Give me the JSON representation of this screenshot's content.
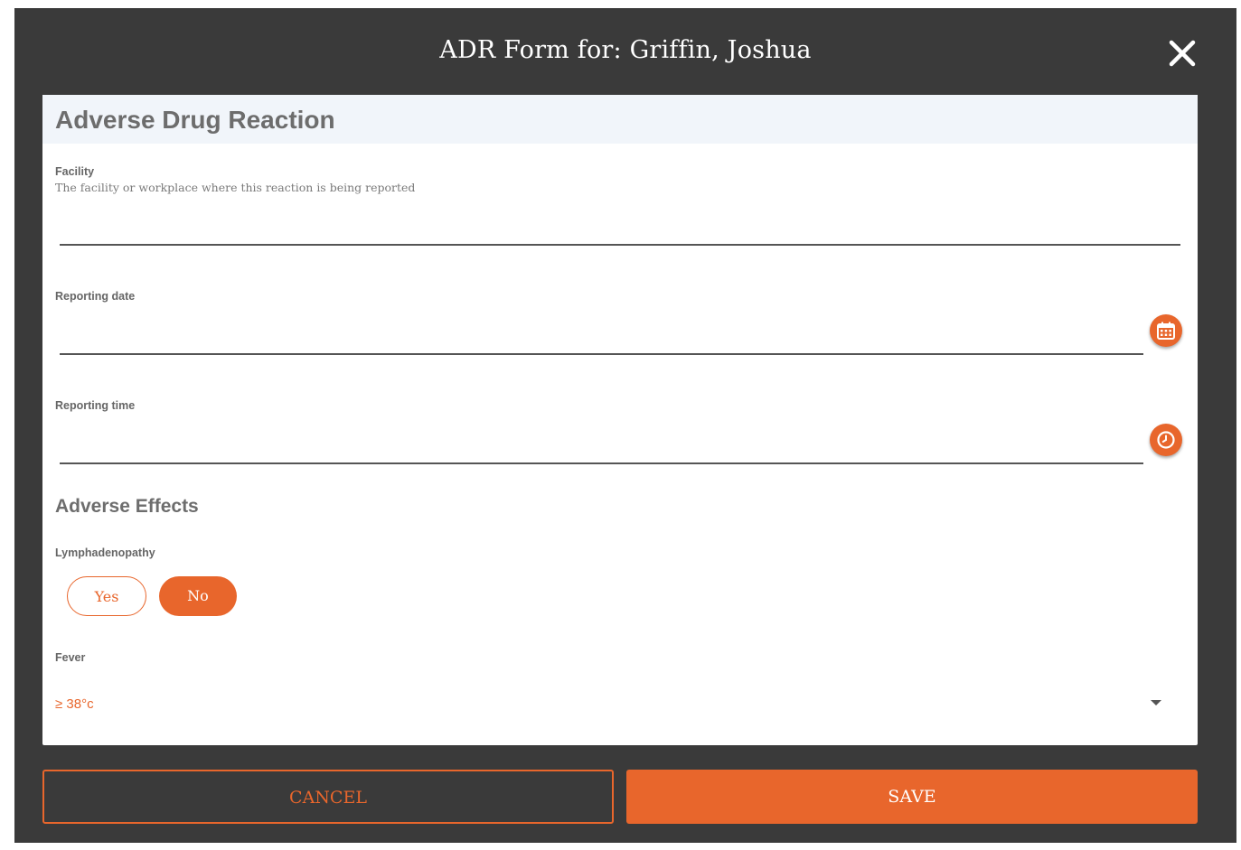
{
  "dialog": {
    "title": "ADR Form for: Griffin, Joshua",
    "close_icon": "close-icon"
  },
  "form": {
    "heading": "Adverse Drug Reaction",
    "facility": {
      "label": "Facility",
      "hint": "The facility or workplace where this reaction is being reported",
      "value": ""
    },
    "reporting_date": {
      "label": "Reporting date",
      "value": "",
      "icon": "calendar-icon"
    },
    "reporting_time": {
      "label": "Reporting time",
      "value": "",
      "icon": "clock-icon"
    },
    "adverse_effects": {
      "section_title": "Adverse Effects",
      "lymphadenopathy": {
        "label": "Lymphadenopathy",
        "options": [
          "Yes",
          "No"
        ],
        "selected": "No"
      },
      "fever": {
        "label": "Fever",
        "selected_value": "≥ 38°c"
      }
    }
  },
  "footer": {
    "cancel_label": "CANCEL",
    "save_label": "SAVE"
  },
  "colors": {
    "accent": "#e8662c",
    "dialog_background": "#3a3a3a",
    "heading_background": "#f1f5fa"
  }
}
